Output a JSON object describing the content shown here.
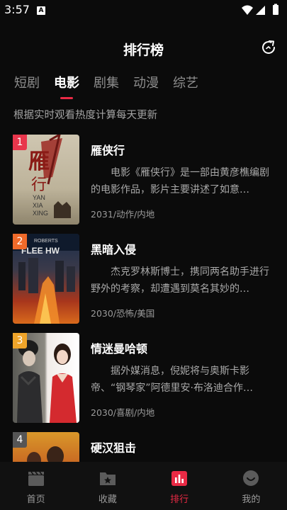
{
  "status": {
    "time": "3:57",
    "notif_icon": "A"
  },
  "header": {
    "title": "排行榜",
    "refresh_icon": "refresh-icon"
  },
  "tabs": [
    {
      "label": "短剧",
      "active": false
    },
    {
      "label": "电影",
      "active": true
    },
    {
      "label": "剧集",
      "active": false
    },
    {
      "label": "动漫",
      "active": false
    },
    {
      "label": "综艺",
      "active": false
    }
  ],
  "subtitle": "根据实时观看热度计算每天更新",
  "items": [
    {
      "rank": "1",
      "rank_color": "#e8364c",
      "title": "雁侠行",
      "desc": "电影《雁侠行》是一部由黄彦樵编剧的电影作品，影片主要讲述了如意…",
      "meta": "2031/动作/内地",
      "poster_text": "YAN XIA XING"
    },
    {
      "rank": "2",
      "rank_color": "#ef6a2a",
      "title": "黑暗入侵",
      "desc": "杰克罗林斯博士，携同两名助手进行野外的考察，却遭遇到莫名其妙的…",
      "meta": "2030/恐怖/美国",
      "poster_text": "ROBERTS"
    },
    {
      "rank": "3",
      "rank_color": "#eea42a",
      "title": "情迷曼哈顿",
      "desc": "据外媒消息，倪妮将与奥斯卡影帝、“钢琴家”阿德里安·布洛迪合作…",
      "meta": "2030/喜剧/内地",
      "poster_text": ""
    },
    {
      "rank": "4",
      "rank_color": "#555555",
      "title": "硬汉狙击",
      "desc": "",
      "meta": "",
      "poster_text": ""
    }
  ],
  "nav": [
    {
      "label": "首页",
      "icon": "clapperboard-icon",
      "active": false
    },
    {
      "label": "收藏",
      "icon": "folder-star-icon",
      "active": false
    },
    {
      "label": "排行",
      "icon": "bar-chart-icon",
      "active": true
    },
    {
      "label": "我的",
      "icon": "smiley-face-icon",
      "active": false
    }
  ],
  "colors": {
    "accent": "#ea2a45",
    "background": "#0b0b0b"
  }
}
